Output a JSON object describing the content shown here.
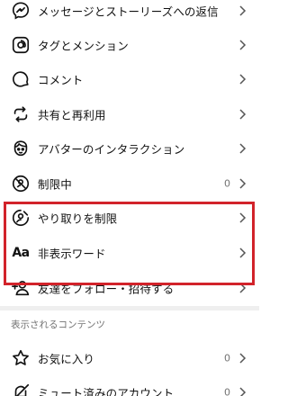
{
  "menu_items": [
    {
      "label": "メッセージとストーリーズへの返信",
      "icon": "messenger-icon"
    },
    {
      "label": "タグとメンション",
      "icon": "at-sign-icon"
    },
    {
      "label": "コメント",
      "icon": "comment-bubble-icon"
    },
    {
      "label": "共有と再利用",
      "icon": "repost-icon"
    },
    {
      "label": "アバターのインタラクション",
      "icon": "avatar-face-icon"
    },
    {
      "label": "制限中",
      "icon": "restricted-icon",
      "count": "0"
    },
    {
      "label": "やり取りを制限",
      "icon": "limit-interactions-icon"
    },
    {
      "label": "非表示ワード",
      "icon": "Aa",
      "highlighted": true
    },
    {
      "label": "友達をフォロー・招待する",
      "icon": "add-person-icon"
    }
  ],
  "section_header": "表示されるコンテンツ",
  "content_items": [
    {
      "label": "お気に入り",
      "icon": "star-icon",
      "count": "0"
    },
    {
      "label": "ミュート済みのアカウント",
      "icon": "muted-icon",
      "count": "0"
    }
  ],
  "highlight_color": "#d2232a"
}
